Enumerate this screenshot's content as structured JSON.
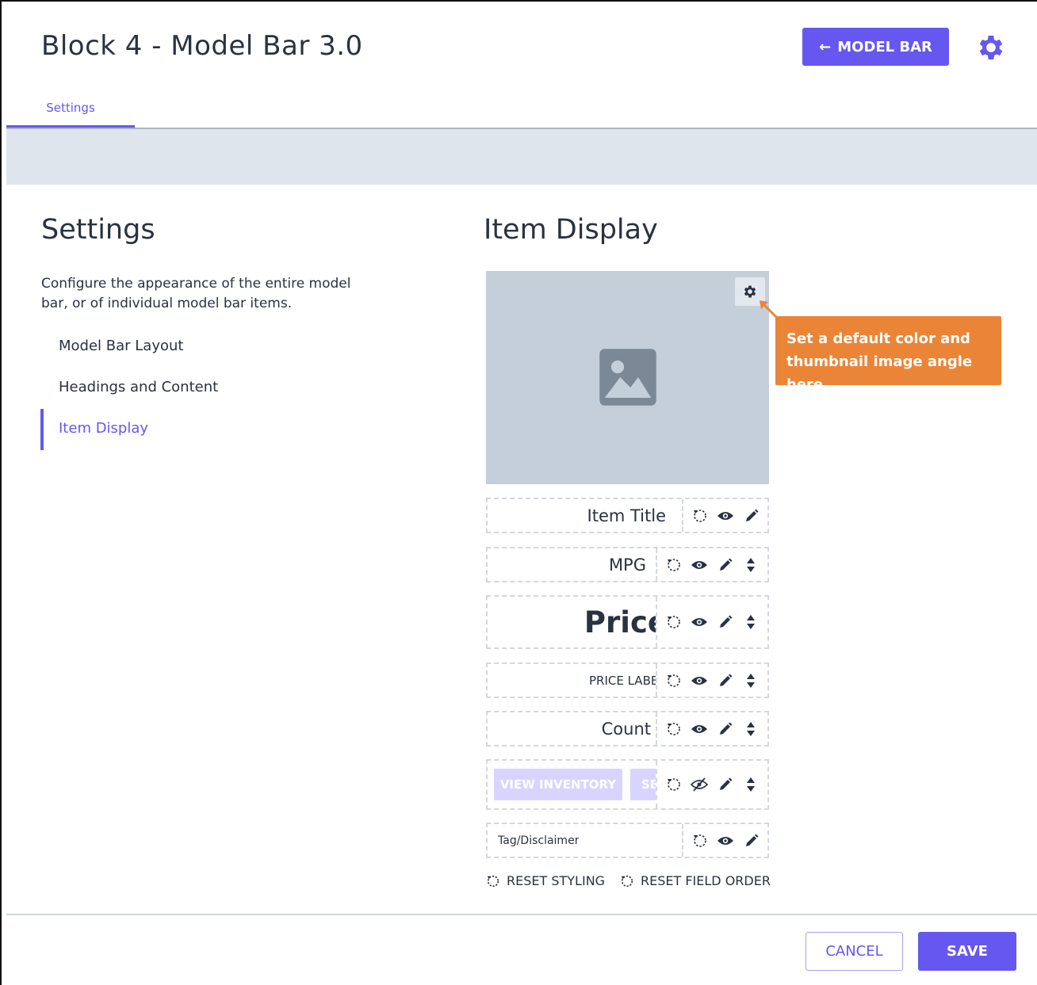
{
  "header": {
    "title": "Block 4 - Model Bar 3.0",
    "back_button_label": "MODEL BAR",
    "back_arrow": "←"
  },
  "tabs": [
    {
      "label": "Settings",
      "active": true
    }
  ],
  "sidebar": {
    "title": "Settings",
    "description": "Configure the appearance of the entire model bar, or of individual model bar items.",
    "items": [
      {
        "label": "Model Bar Layout",
        "active": false
      },
      {
        "label": "Headings and Content",
        "active": false
      },
      {
        "label": "Item Display",
        "active": true
      }
    ]
  },
  "main": {
    "title": "Item Display",
    "tooltip": "Set a default color and thumbnail image angle here",
    "fields": [
      {
        "label": "Item Title",
        "hidden": false,
        "reorderable": false
      },
      {
        "label": "MPG",
        "hidden": false,
        "reorderable": true
      },
      {
        "label": "Price",
        "hidden": false,
        "reorderable": true
      },
      {
        "label": "PRICE LABEL",
        "hidden": false,
        "reorderable": true
      },
      {
        "label": "Count",
        "hidden": false,
        "reorderable": true
      },
      {
        "label": "",
        "hidden": true,
        "reorderable": true,
        "buttons": [
          "VIEW INVENTORY",
          "SE"
        ]
      },
      {
        "label": "Tag/Disclaimer",
        "hidden": false,
        "reorderable": false
      }
    ],
    "reset_styling_label": "RESET STYLING",
    "reset_order_label": "RESET FIELD ORDER"
  },
  "footer": {
    "cancel_label": "CANCEL",
    "save_label": "SAVE"
  },
  "colors": {
    "accent": "#6657f0",
    "tooltip": "#ea8537",
    "thumbnail_bg": "#c4cfd9",
    "banner": "#dfe5ed"
  },
  "icons": [
    "gear-icon",
    "image-icon",
    "reset-icon",
    "eye-icon",
    "eye-off-icon",
    "pencil-icon",
    "sort-icon",
    "arrow-left-icon"
  ]
}
